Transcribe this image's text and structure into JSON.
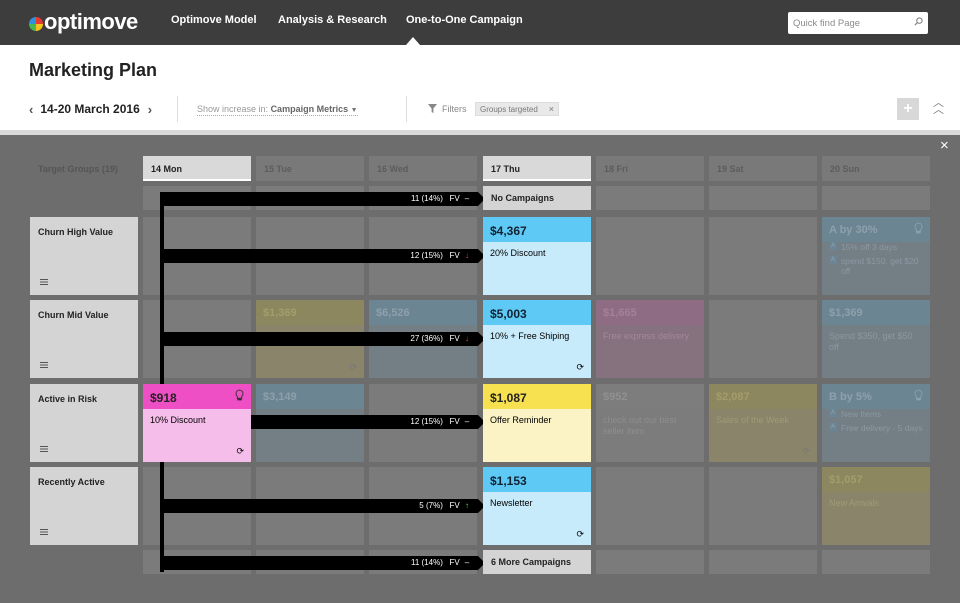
{
  "app": {
    "logo": "optimove"
  },
  "nav": {
    "items": [
      "Optimove Model",
      "Analysis & Research",
      "One-to-One Campaign"
    ],
    "active": "One-to-One Campaign"
  },
  "search": {
    "placeholder": "Quick find Page"
  },
  "page": {
    "title": "Marketing Plan"
  },
  "toolbar": {
    "date_range": "14-20 March 2016",
    "show_increase_label": "Show increase in:",
    "show_increase_value": "Campaign Metrics",
    "filters_label": "Filters",
    "filter_chip": "Groups targeted",
    "chip_close": "×",
    "add_label": "+"
  },
  "overlay": {
    "close": "×"
  },
  "grid": {
    "target_groups_header": "Target Groups (19)",
    "days": [
      "14 Mon",
      "15 Tue",
      "16 Wed",
      "17 Thu",
      "18 Fri",
      "19 Sat",
      "20 Sun"
    ],
    "rows": [
      "Churn High Value",
      "Churn Mid Value",
      "Active in Risk",
      "Recently Active"
    ]
  },
  "highlight_campaigns": {
    "mon_active_in_risk": {
      "amount": "$918",
      "text": "10% Discount"
    },
    "thu_churn_high": {
      "amount": "$4,367",
      "text": "20% Discount"
    },
    "thu_churn_mid": {
      "amount": "$5,003",
      "text": "10% + Free Shiping"
    },
    "thu_active_in_risk": {
      "amount": "$1,087",
      "text": "Offer Reminder"
    },
    "thu_recently_active": {
      "amount": "$1,153",
      "text": "Newsletter"
    },
    "thu_no_campaigns": "No Campaigns",
    "thu_more_campaigns": "6 More Campaigns"
  },
  "dim_campaigns": {
    "tue_churn_mid": {
      "amount": "$1,369"
    },
    "wed_churn_mid": {
      "amount": "$6,526"
    },
    "tue_active_in_risk": {
      "amount": "$3,149"
    },
    "fri_churn_mid": {
      "amount": "$1,665",
      "text": "Free express delivery"
    },
    "fri_active_in_risk": {
      "amount": "$952",
      "text": "check out our best seller item"
    },
    "sat_active_in_risk": {
      "amount": "$2,087",
      "text": "Sales of the Week"
    },
    "sun_churn_high": {
      "title": "A by 30%",
      "items": [
        "15% off 3 days",
        "spend $150, get $20 off"
      ],
      "marker": "A"
    },
    "sun_churn_mid": {
      "amount": "$1,369",
      "text": "Spend $350, get $50 off"
    },
    "sun_active_in_risk": {
      "title": "B by 5%",
      "items": [
        "New Items",
        "Free delivery - 5 days"
      ],
      "marker": "A"
    },
    "sun_recently_active": {
      "amount": "$1,057",
      "text": "New Arrivals"
    }
  },
  "flows": [
    {
      "count": "11 (14%)",
      "metric": "FV",
      "trend": "flat",
      "symbol": "–"
    },
    {
      "count": "12 (15%)",
      "metric": "FV",
      "trend": "down",
      "symbol": "↓"
    },
    {
      "count": "27 (36%)",
      "metric": "FV",
      "trend": "down",
      "symbol": "↓"
    },
    {
      "count": "12 (15%)",
      "metric": "FV",
      "trend": "flat",
      "symbol": "–"
    },
    {
      "count": "5 (7%)",
      "metric": "FV",
      "trend": "up",
      "symbol": "↑"
    },
    {
      "count": "11 (14%)",
      "metric": "FV",
      "trend": "flat",
      "symbol": "–"
    }
  ],
  "colors": {
    "topbar": "#3d3d3d",
    "overlay": "#6d6d6d",
    "pink": "#ee4fc4",
    "blue": "#5ec9f4",
    "yellow": "#f7e151",
    "trend_down": "#ff3b3b",
    "trend_up": "#4fe04f"
  }
}
